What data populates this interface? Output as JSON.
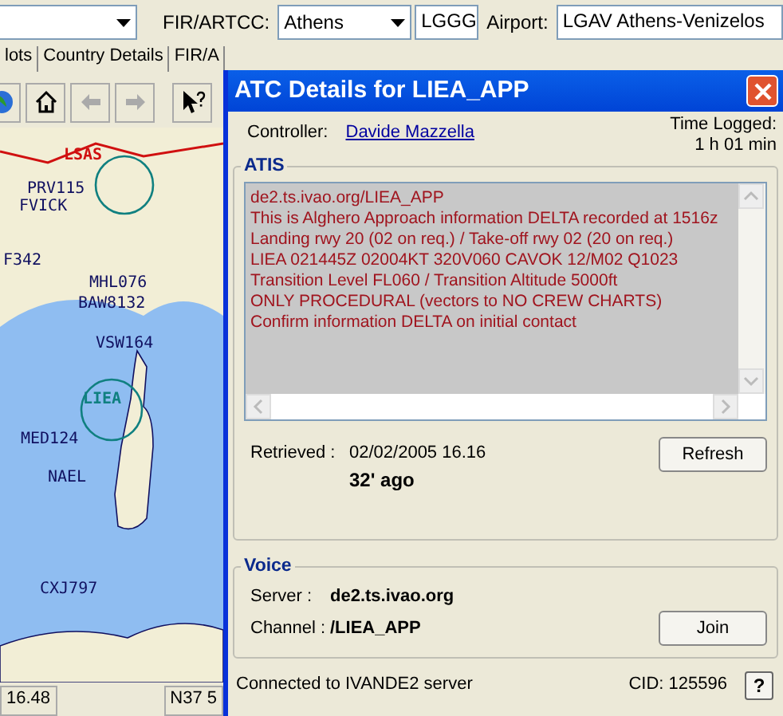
{
  "toolbar": {
    "fir_label": "FIR/ARTCC:",
    "fir_combo": {
      "value": "Athens"
    },
    "fir_code": {
      "value": "LGGG"
    },
    "airport_label": "Airport:",
    "airport_field": {
      "value": "LGAV Athens-Venizelos"
    }
  },
  "tabs": [
    {
      "label": "lots",
      "selected": false
    },
    {
      "label": "Country Details",
      "selected": false
    },
    {
      "label": "FIR/A",
      "selected": false
    }
  ],
  "map": {
    "labels": [
      {
        "text": "LSAS",
        "kind": "airport"
      },
      {
        "text": "PRV115",
        "kind": "flight"
      },
      {
        "text": "FVICK",
        "kind": "flight"
      },
      {
        "text": "F342",
        "kind": "flight"
      },
      {
        "text": "MHL076",
        "kind": "flight"
      },
      {
        "text": "BAW8132",
        "kind": "flight"
      },
      {
        "text": "VSW164",
        "kind": "flight"
      },
      {
        "text": "LIEA",
        "kind": "station"
      },
      {
        "text": "MED124",
        "kind": "flight"
      },
      {
        "text": "NAEL",
        "kind": "flight"
      },
      {
        "text": "CXJ797",
        "kind": "flight"
      }
    ]
  },
  "status_bar": {
    "time": "16.48",
    "coords": "N37 5"
  },
  "dialog": {
    "title": "ATC Details for LIEA_APP",
    "controller_label": "Controller:",
    "controller": "Davide Mazzella",
    "time_logged_label": "Time Logged:",
    "time_logged": "1 h 01 min",
    "atis": {
      "legend": "ATIS",
      "lines": [
        "de2.ts.ivao.org/LIEA_APP",
        "This is Alghero Approach information DELTA recorded at 1516z",
        "Landing rwy 20 (02 on req.) / Take-off rwy 02 (20 on req.)",
        "LIEA 021445Z 02004KT 320V060 CAVOK 12/M02 Q1023",
        "Transition Level FL060 / Transition Altitude 5000ft",
        "ONLY PROCEDURAL (vectors to NO CREW CHARTS)",
        "Confirm information DELTA on initial contact"
      ],
      "retrieved_label": "Retrieved :",
      "retrieved": "02/02/2005 16.16",
      "age": "32' ago",
      "refresh_button": "Refresh"
    },
    "voice": {
      "legend": "Voice",
      "server_label": "Server :",
      "server": "de2.ts.ivao.org",
      "channel_label": "Channel :",
      "channel": "/LIEA_APP",
      "join_button": "Join"
    },
    "status": "Connected to IVANDE2 server",
    "cid": "CID: 125596",
    "help_button": "?"
  }
}
